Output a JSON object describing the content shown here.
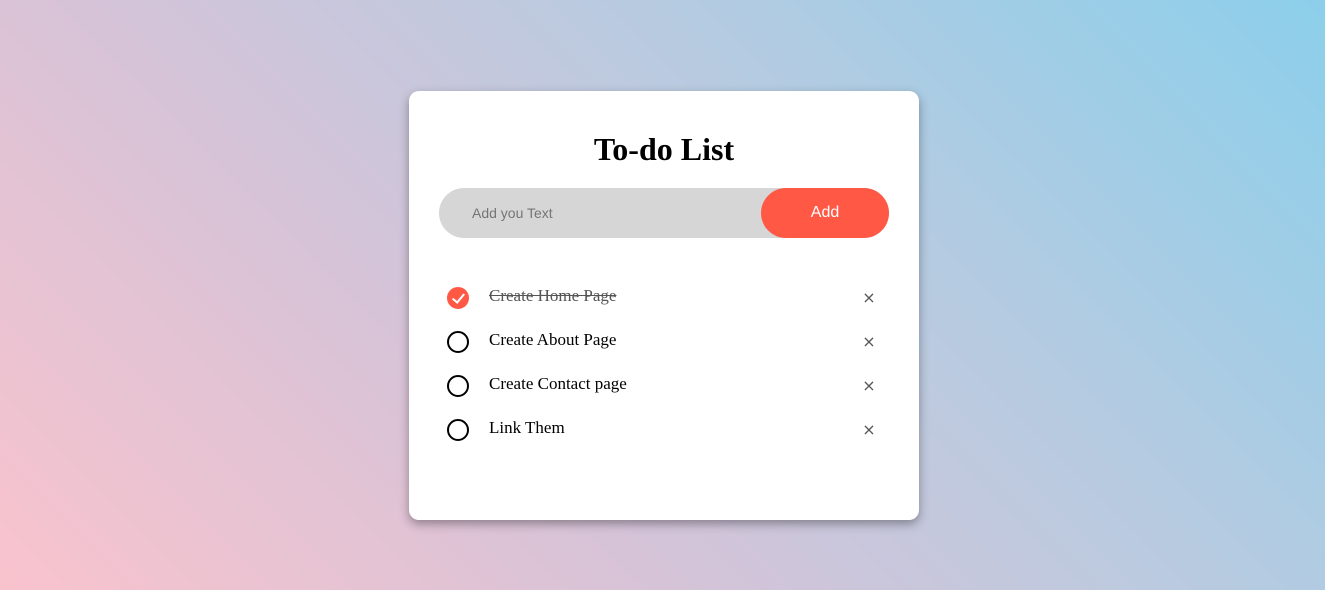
{
  "app": {
    "title": "To-do List"
  },
  "input": {
    "placeholder": "Add you Text",
    "value": ""
  },
  "add_button": {
    "label": "Add"
  },
  "tasks": [
    {
      "text": "Create Home Page",
      "done": true
    },
    {
      "text": "Create About Page",
      "done": false
    },
    {
      "text": "Create Contact page",
      "done": false
    },
    {
      "text": "Link Them",
      "done": false
    }
  ],
  "icons": {
    "checkbox": "circle-checkbox-icon",
    "checked": "checkmark-icon",
    "remove": "close-icon",
    "remove_glyph": "×"
  },
  "colors": {
    "accent": "#ff5945",
    "input_bg": "#d6d6d6",
    "card_bg": "#ffffff",
    "gradient_start": "#f9c3cd",
    "gradient_end": "#8ccfeb"
  }
}
